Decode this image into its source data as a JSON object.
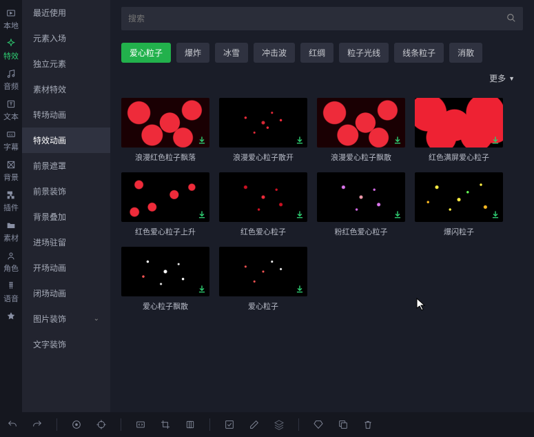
{
  "rail": [
    {
      "icon": "video",
      "label": "本地"
    },
    {
      "icon": "sparkle",
      "label": "特效",
      "active": true
    },
    {
      "icon": "music",
      "label": "音频"
    },
    {
      "icon": "text",
      "label": "文本"
    },
    {
      "icon": "cc",
      "label": "字幕"
    },
    {
      "icon": "pattern",
      "label": "背景"
    },
    {
      "icon": "puzzle",
      "label": "插件"
    },
    {
      "icon": "folder",
      "label": "素材"
    },
    {
      "icon": "person",
      "label": "角色"
    },
    {
      "icon": "mic",
      "label": "语音"
    },
    {
      "icon": "star",
      "label": ""
    }
  ],
  "sidebar": {
    "items": [
      {
        "label": "最近使用"
      },
      {
        "label": "元素入场"
      },
      {
        "label": "独立元素"
      },
      {
        "label": "素材特效"
      },
      {
        "label": "转场动画"
      },
      {
        "label": "特效动画",
        "selected": true
      },
      {
        "label": "前景遮罩"
      },
      {
        "label": "前景装饰"
      },
      {
        "label": "背景叠加"
      },
      {
        "label": "进场驻留"
      },
      {
        "label": "开场动画"
      },
      {
        "label": "闭场动画"
      },
      {
        "label": "图片装饰",
        "expandable": true
      },
      {
        "label": "文字装饰"
      }
    ]
  },
  "search": {
    "placeholder": "搜索"
  },
  "tabs": [
    {
      "label": "爱心粒子",
      "active": true
    },
    {
      "label": "爆炸"
    },
    {
      "label": "冰雪"
    },
    {
      "label": "冲击波"
    },
    {
      "label": "红绸"
    },
    {
      "label": "粒子光线"
    },
    {
      "label": "线条粒子"
    },
    {
      "label": "消散"
    }
  ],
  "more_label": "更多",
  "items": [
    {
      "title": "浪漫红色粒子飘落",
      "thumb": "hearts-fill"
    },
    {
      "title": "浪漫爱心粒子散开",
      "thumb": "sparse-red"
    },
    {
      "title": "浪漫爱心粒子飘散",
      "thumb": "hearts-fill"
    },
    {
      "title": "红色满屏爱心粒子",
      "thumb": "hearts-cover"
    },
    {
      "title": "红色爱心粒子上升",
      "thumb": "scatter-red"
    },
    {
      "title": "红色爱心粒子",
      "thumb": "dots-red"
    },
    {
      "title": "粉红色爱心粒子",
      "thumb": "dots-pink"
    },
    {
      "title": "爆闪粒子",
      "thumb": "burst-ylw"
    },
    {
      "title": "爱心粒子飘散",
      "thumb": "dots-white"
    },
    {
      "title": "爱心粒子",
      "thumb": "dots-wr"
    }
  ],
  "toolbar_icons": [
    "undo",
    "redo",
    "sep",
    "target",
    "crosshair",
    "sep",
    "code",
    "crop",
    "clone",
    "sep",
    "check-sq",
    "edit",
    "layers",
    "sep",
    "gem",
    "copy",
    "trash"
  ]
}
